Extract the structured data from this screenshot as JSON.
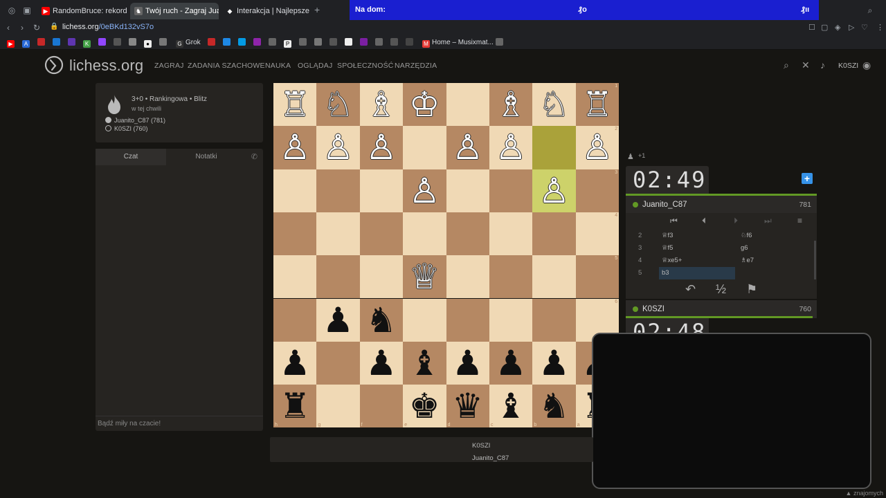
{
  "browser": {
    "tabs": [
      {
        "title": "RandomBruce: rekordowy",
        "favicon": "youtube-icon",
        "color": "#ff0000"
      },
      {
        "title": "Twój ruch - Zagraj Juanito",
        "favicon": "lichess-icon",
        "color": "#555555"
      },
      {
        "title": "Interakcja | Najlepsze opr",
        "favicon": "diamond-icon",
        "color": "#333333"
      }
    ],
    "bluebar": {
      "left_text": "Na dom:",
      "mid_text": "₰o",
      "right_text": "₰ıı"
    },
    "url": {
      "host": "lichess.org",
      "path": "/0eBKd132vS7o"
    },
    "bookmarks": [
      {
        "label": "Grok",
        "icon": "grok-icon"
      },
      {
        "label": "Home – Musixmat...",
        "icon": "musixmatch-icon"
      }
    ]
  },
  "site": {
    "logo_text": "lichess.org",
    "nav": [
      "ZAGRAJ",
      "ZADANIA SZACHOWE",
      "NAUKA",
      "OGLĄDAJ",
      "SPOŁECZNOŚĆ",
      "NARZĘDZIA"
    ],
    "username": "K0SZI"
  },
  "game": {
    "title": "3+0 • Rankingowa • Blitz",
    "subtitle": "w tej chwili",
    "white_player": "Juanito_C87 (781)",
    "black_player": "K0SZI (760)"
  },
  "chat": {
    "tab_chat": "Czat",
    "tab_notes": "Notatki",
    "placeholder": "Bądź miły na czacie!"
  },
  "board": {
    "pieces": [
      [
        "♖",
        "♘",
        "♗",
        "♔",
        "",
        "♗",
        "♘",
        "♖"
      ],
      [
        "♙",
        "♙",
        "♙",
        "",
        "♙",
        "♙",
        "",
        "♙"
      ],
      [
        "",
        "",
        "",
        "♙",
        "",
        "",
        "♙",
        ""
      ],
      [
        "",
        "",
        "",
        "",
        "",
        "",
        "",
        ""
      ],
      [
        "",
        "",
        "",
        "♕",
        "",
        "",
        "",
        ""
      ],
      [
        "",
        "♟",
        "♞",
        "",
        "",
        "",
        "",
        ""
      ],
      [
        "♟",
        "",
        "♟",
        "♝",
        "♟",
        "♟",
        "♟",
        "♟"
      ],
      [
        "♜",
        "",
        "",
        "♚",
        "♛",
        "♝",
        "♞",
        "♜"
      ]
    ],
    "colors": [
      [
        "w",
        "w",
        "w",
        "w",
        "",
        "w",
        "w",
        "w"
      ],
      [
        "w",
        "w",
        "w",
        "",
        "w",
        "w",
        "",
        "w"
      ],
      [
        "",
        "",
        "",
        "w",
        "",
        "",
        "w",
        ""
      ],
      [
        "",
        "",
        "",
        "",
        "",
        "",
        "",
        ""
      ],
      [
        "",
        "",
        "",
        "w",
        "",
        "",
        "",
        ""
      ],
      [
        "",
        "b",
        "b",
        "",
        "",
        "",
        "",
        ""
      ],
      [
        "b",
        "",
        "b",
        "b",
        "b",
        "b",
        "b",
        "b"
      ],
      [
        "b",
        "",
        "",
        "b",
        "b",
        "b",
        "b",
        "b"
      ]
    ],
    "files": [
      "h",
      "g",
      "f",
      "e",
      "d",
      "c",
      "b",
      "a"
    ],
    "ranks": [
      "1",
      "2",
      "3",
      "4",
      "5",
      "6",
      "7",
      "8"
    ],
    "light_color": "#f0d9b5",
    "dark_color": "#b58863",
    "highlight_color": "#aaa23a"
  },
  "right_panel": {
    "spectators": "+1",
    "top_clock": "02:49",
    "top_player": "Juanito_C87",
    "top_rating": "781",
    "moves": [
      {
        "n": "2",
        "w": "♕f3",
        "b": "♘f6"
      },
      {
        "n": "3",
        "w": "♕f5",
        "b": "g6"
      },
      {
        "n": "4",
        "w": "♕xe5+",
        "b": "♗e7"
      },
      {
        "n": "5",
        "w": "b3",
        "b": ""
      }
    ],
    "half_label": "½",
    "bottom_player": "K0SZI",
    "bottom_rating": "760",
    "bottom_clock": "02:48"
  },
  "under_board": {
    "name1": "K0SZI",
    "name2": "Juanito_C87"
  },
  "bottom_badge": "znajomych"
}
